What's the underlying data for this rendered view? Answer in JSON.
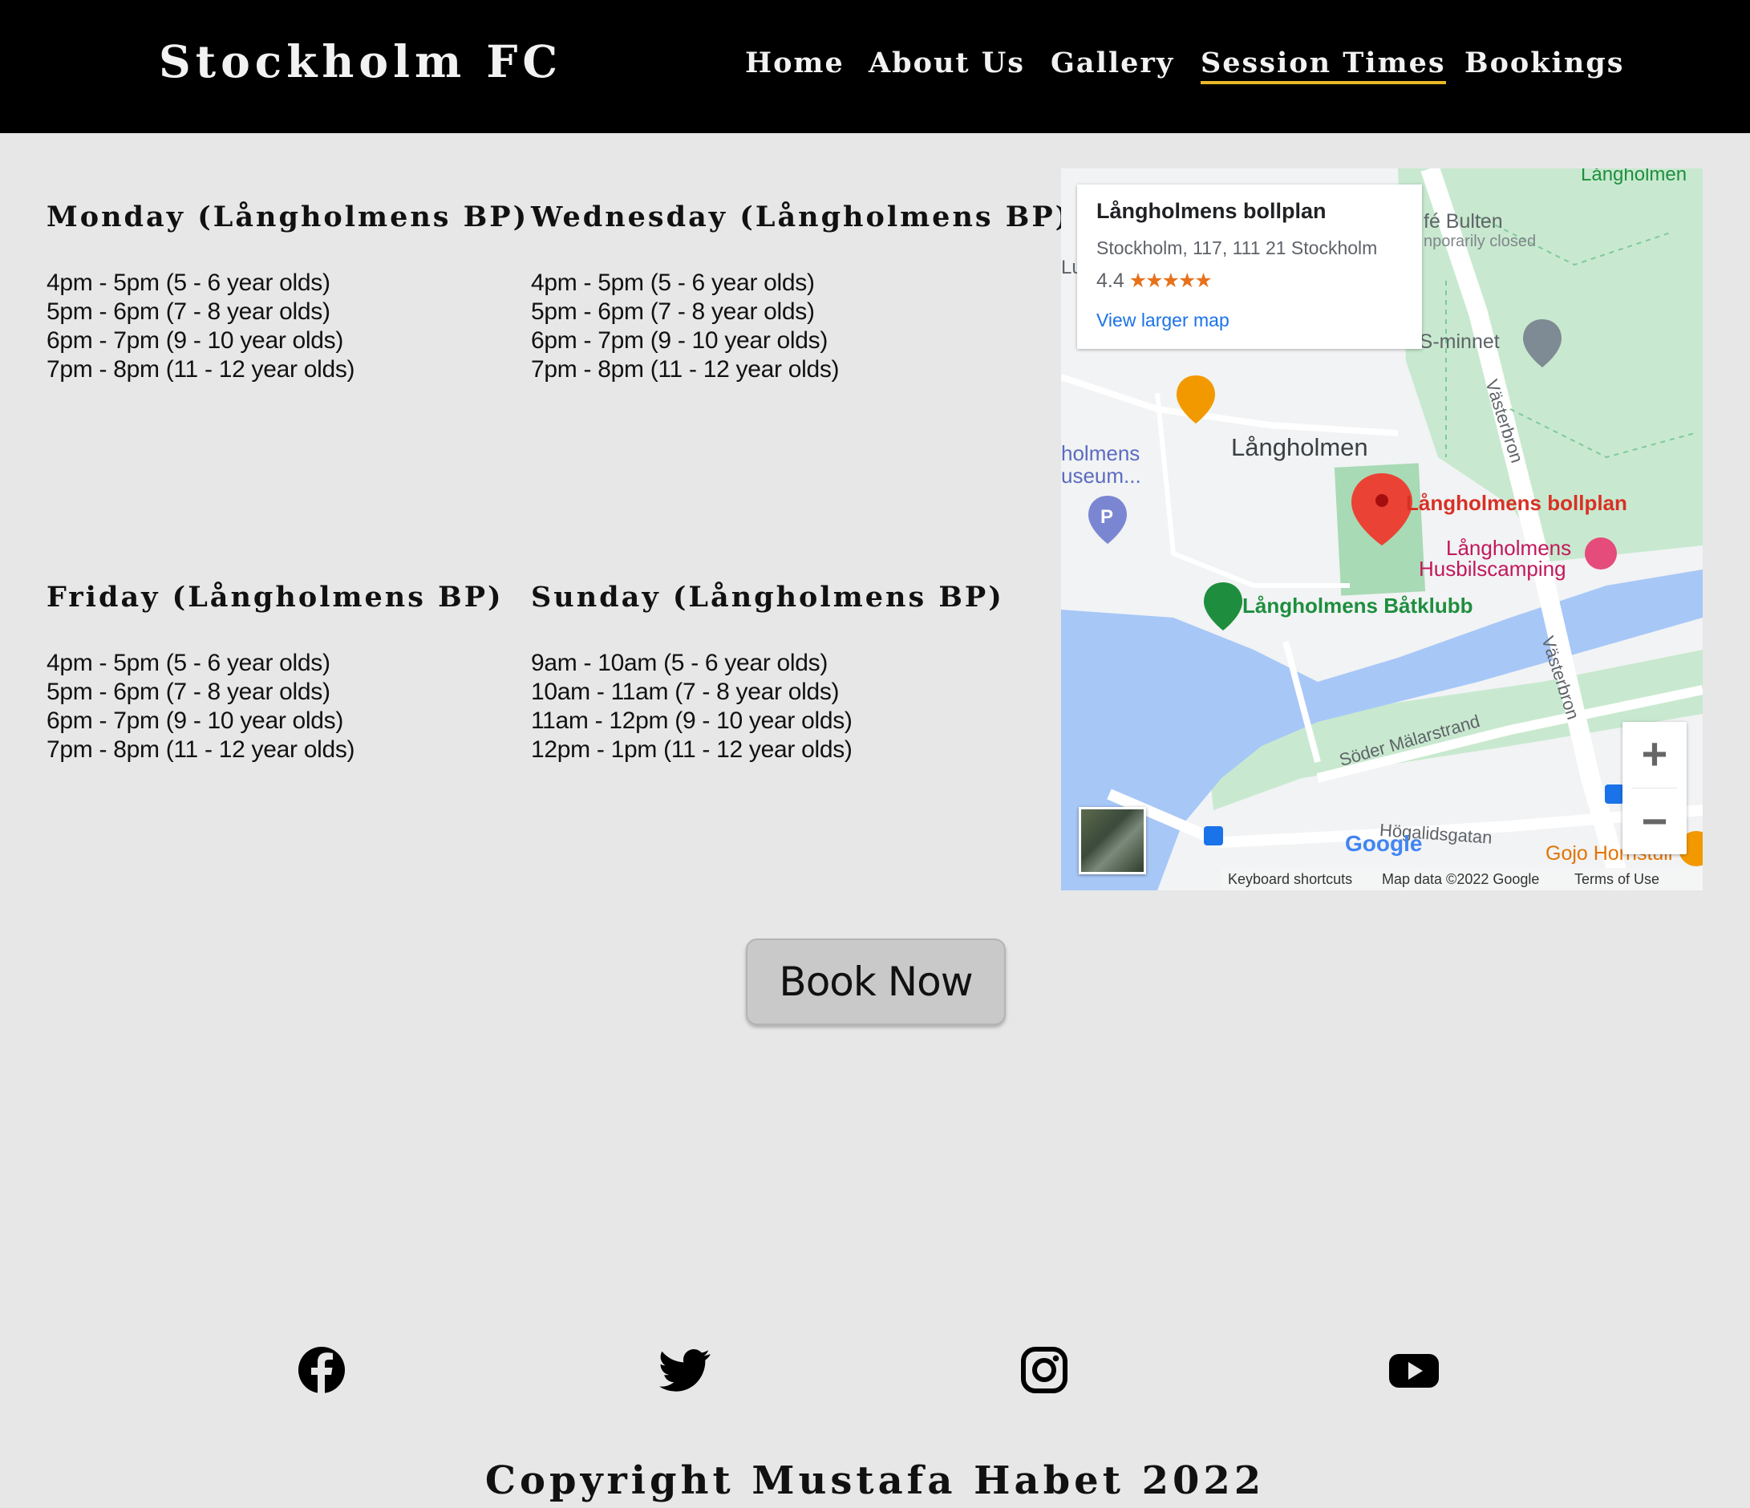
{
  "header": {
    "brand": "Stockholm FC",
    "nav": [
      "Home",
      "About Us",
      "Gallery",
      "Session Times",
      "Bookings"
    ],
    "active": "Session Times",
    "accent_color": "#e8b829"
  },
  "schedule": {
    "monday": {
      "title": "Monday (Långholmens BP)",
      "sessions": [
        "4pm - 5pm (5 - 6 year olds)",
        "5pm - 6pm (7 - 8 year olds)",
        "6pm - 7pm (9 - 10 year olds)",
        "7pm - 8pm (11 - 12 year olds)"
      ]
    },
    "wednesday": {
      "title": "Wednesday (Långholmens BP)",
      "sessions": [
        "4pm - 5pm (5 - 6 year olds)",
        "5pm - 6pm (7 - 8 year olds)",
        "6pm - 7pm (9 - 10 year olds)",
        "7pm - 8pm (11 - 12 year olds)"
      ]
    },
    "friday": {
      "title": "Friday (Långholmens BP)",
      "sessions": [
        "4pm - 5pm (5 - 6 year olds)",
        "5pm - 6pm (7 - 8 year olds)",
        "6pm - 7pm (9 - 10 year olds)",
        "7pm - 8pm (11 - 12 year olds)"
      ]
    },
    "sunday": {
      "title": "Sunday (Långholmens BP)",
      "sessions": [
        "9am - 10am (5 - 6 year olds)",
        "10am - 11am (7 - 8 year olds)",
        "11am - 12pm (9 - 10 year olds)",
        "12pm - 1pm (11 - 12 year olds)"
      ]
    }
  },
  "map": {
    "card": {
      "place": "Långholmens bollplan",
      "address": "Stockholm, 117, 111 21 Stockholm",
      "rating": "4.4",
      "stars": "★★★★★",
      "link": "View larger map"
    },
    "labels": {
      "area": "Långholmen",
      "pin": "Långholmens bollplan",
      "camping_1": "Långholmens",
      "camping_2": "Husbilscamping",
      "boat_club": "Långholmens Båtklubb",
      "bridge_1": "Västerbron",
      "bridge_2": "Västerbron",
      "street_1": "Söder Mälarstrand",
      "street_2": "Högalidsgatan",
      "corner": "Långholmen",
      "cafe": "fé Bulten",
      "cafe_status": "nporarily closed",
      "memorial": "AS-minnet",
      "museum_1": "holmens",
      "museum_2": "useum...",
      "edge": "Lu",
      "restaurant": "Gojo Hornstull",
      "google": "Google"
    },
    "attribution": {
      "shortcuts": "Keyboard shortcuts",
      "data": "Map data ©2022 Google",
      "terms": "Terms of Use"
    },
    "zoom": {
      "plus": "+",
      "minus": "−"
    },
    "colors": {
      "water": "#a7c7f7",
      "park": "#c8e9cf",
      "land": "#f1f3f4",
      "pin": "#ea4335"
    }
  },
  "cta": {
    "label": "Book Now"
  },
  "socials": [
    "facebook-icon",
    "twitter-icon",
    "instagram-icon",
    "youtube-icon"
  ],
  "footer": {
    "copyright": "Copyright Mustafa Habet 2022"
  }
}
